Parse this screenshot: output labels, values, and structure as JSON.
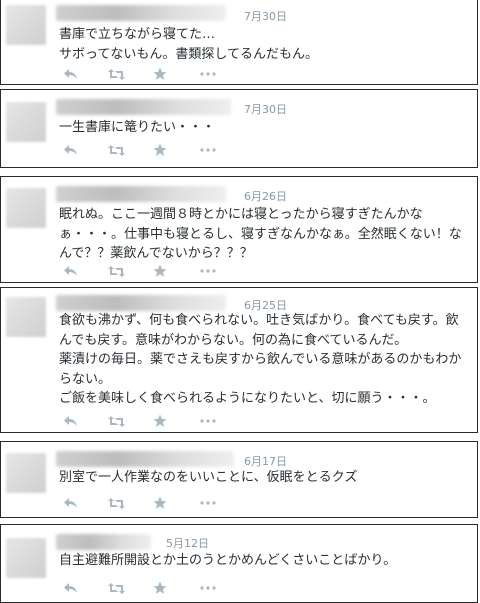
{
  "tweets": [
    {
      "date": "7月30日",
      "text": "書庫で立ちながら寝てた…\nサボってないもん。書類探してるんだもん。"
    },
    {
      "date": "7月30日",
      "text": "一生書庫に篭りたい・・・"
    },
    {
      "date": "6月26日",
      "text": "眠れぬ。ここ一週間８時とかには寝とったから寝すぎたんかなぁ・・・。仕事中も寝とるし、寝すぎなんかなぁ。全然眠くない！なんで？？薬飲んでないから？？？"
    },
    {
      "date": "6月25日",
      "text": "食欲も沸かず、何も食べられない。吐き気ばかり。食べても戻す。飲んでも戻す。意味がわからない。何の為に食べているんだ。\n薬漬けの毎日。薬でさえも戻すから飲んでいる意味があるのかもわからない。\nご飯を美味しく食べられるようになりたいと、切に願う・・・。"
    },
    {
      "date": "6月17日",
      "text": "別室で一人作業なのをいいことに、仮眠をとるクズ"
    },
    {
      "date": "5月12日",
      "text": "自主避難所開設とか土のうとかめんどくさいことばかり。"
    }
  ],
  "icons": {
    "reply": "reply-icon",
    "retweet": "retweet-icon",
    "favorite": "star-icon",
    "more": "more-icon"
  },
  "colors": {
    "text": "#292f33",
    "meta": "#8899a6",
    "icon": "#aab8c2",
    "border": "#2a2a2a"
  }
}
